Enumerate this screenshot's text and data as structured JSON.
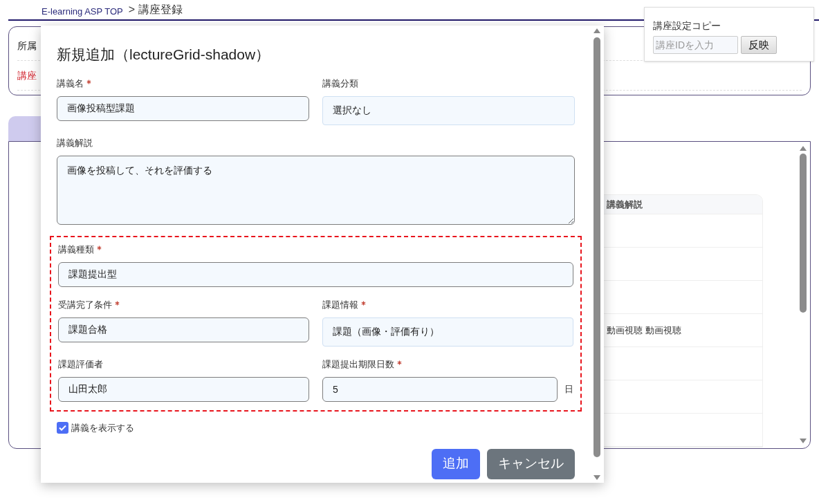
{
  "breadcrumb": {
    "link": "E-learning ASP TOP",
    "current": "> 講座登録"
  },
  "background_form": {
    "rows": [
      {
        "label": "所属",
        "kind": "normal"
      },
      {
        "label": "講座",
        "kind": "required"
      }
    ]
  },
  "background_table": {
    "column": "講義解説",
    "visible_cell": "動画視聴 動画視聴"
  },
  "copy_panel": {
    "title": "講座設定コピー",
    "input": {
      "placeholder": "講座IDを入力"
    },
    "button": "反映"
  },
  "dialog": {
    "title": "新規追加（lectureGrid-shadow）",
    "rows": [
      [
        {
          "label": "講義名",
          "required": true,
          "value": "画像投稿型課題",
          "kind": "text"
        },
        {
          "label": "講義分類",
          "required": false,
          "value": "選択なし",
          "kind": "select"
        }
      ],
      [
        {
          "label": "講義解説",
          "required": false,
          "value": "画像を投稿して、それを評価する",
          "kind": "textarea"
        }
      ]
    ],
    "highlighted_rows": [
      [
        {
          "label": "講義種類",
          "required": true,
          "value": "課題提出型",
          "kind": "text"
        }
      ],
      [
        {
          "label": "受講完了条件",
          "required": true,
          "value": "課題合格",
          "kind": "text"
        },
        {
          "label": "課題情報",
          "required": true,
          "value": "課題（画像・評価有り）",
          "kind": "select"
        }
      ],
      [
        {
          "label": "課題評価者",
          "required": false,
          "value": "山田太郎",
          "kind": "text"
        },
        {
          "label": "課題提出期限日数",
          "required": true,
          "value": "5",
          "kind": "text",
          "unit": "日"
        }
      ]
    ],
    "checkbox": {
      "label": "講義を表示する",
      "checked": true
    },
    "buttons": [
      {
        "label": "追加",
        "kind": "primary"
      },
      {
        "label": "キャンセル",
        "kind": "secondary"
      }
    ]
  }
}
